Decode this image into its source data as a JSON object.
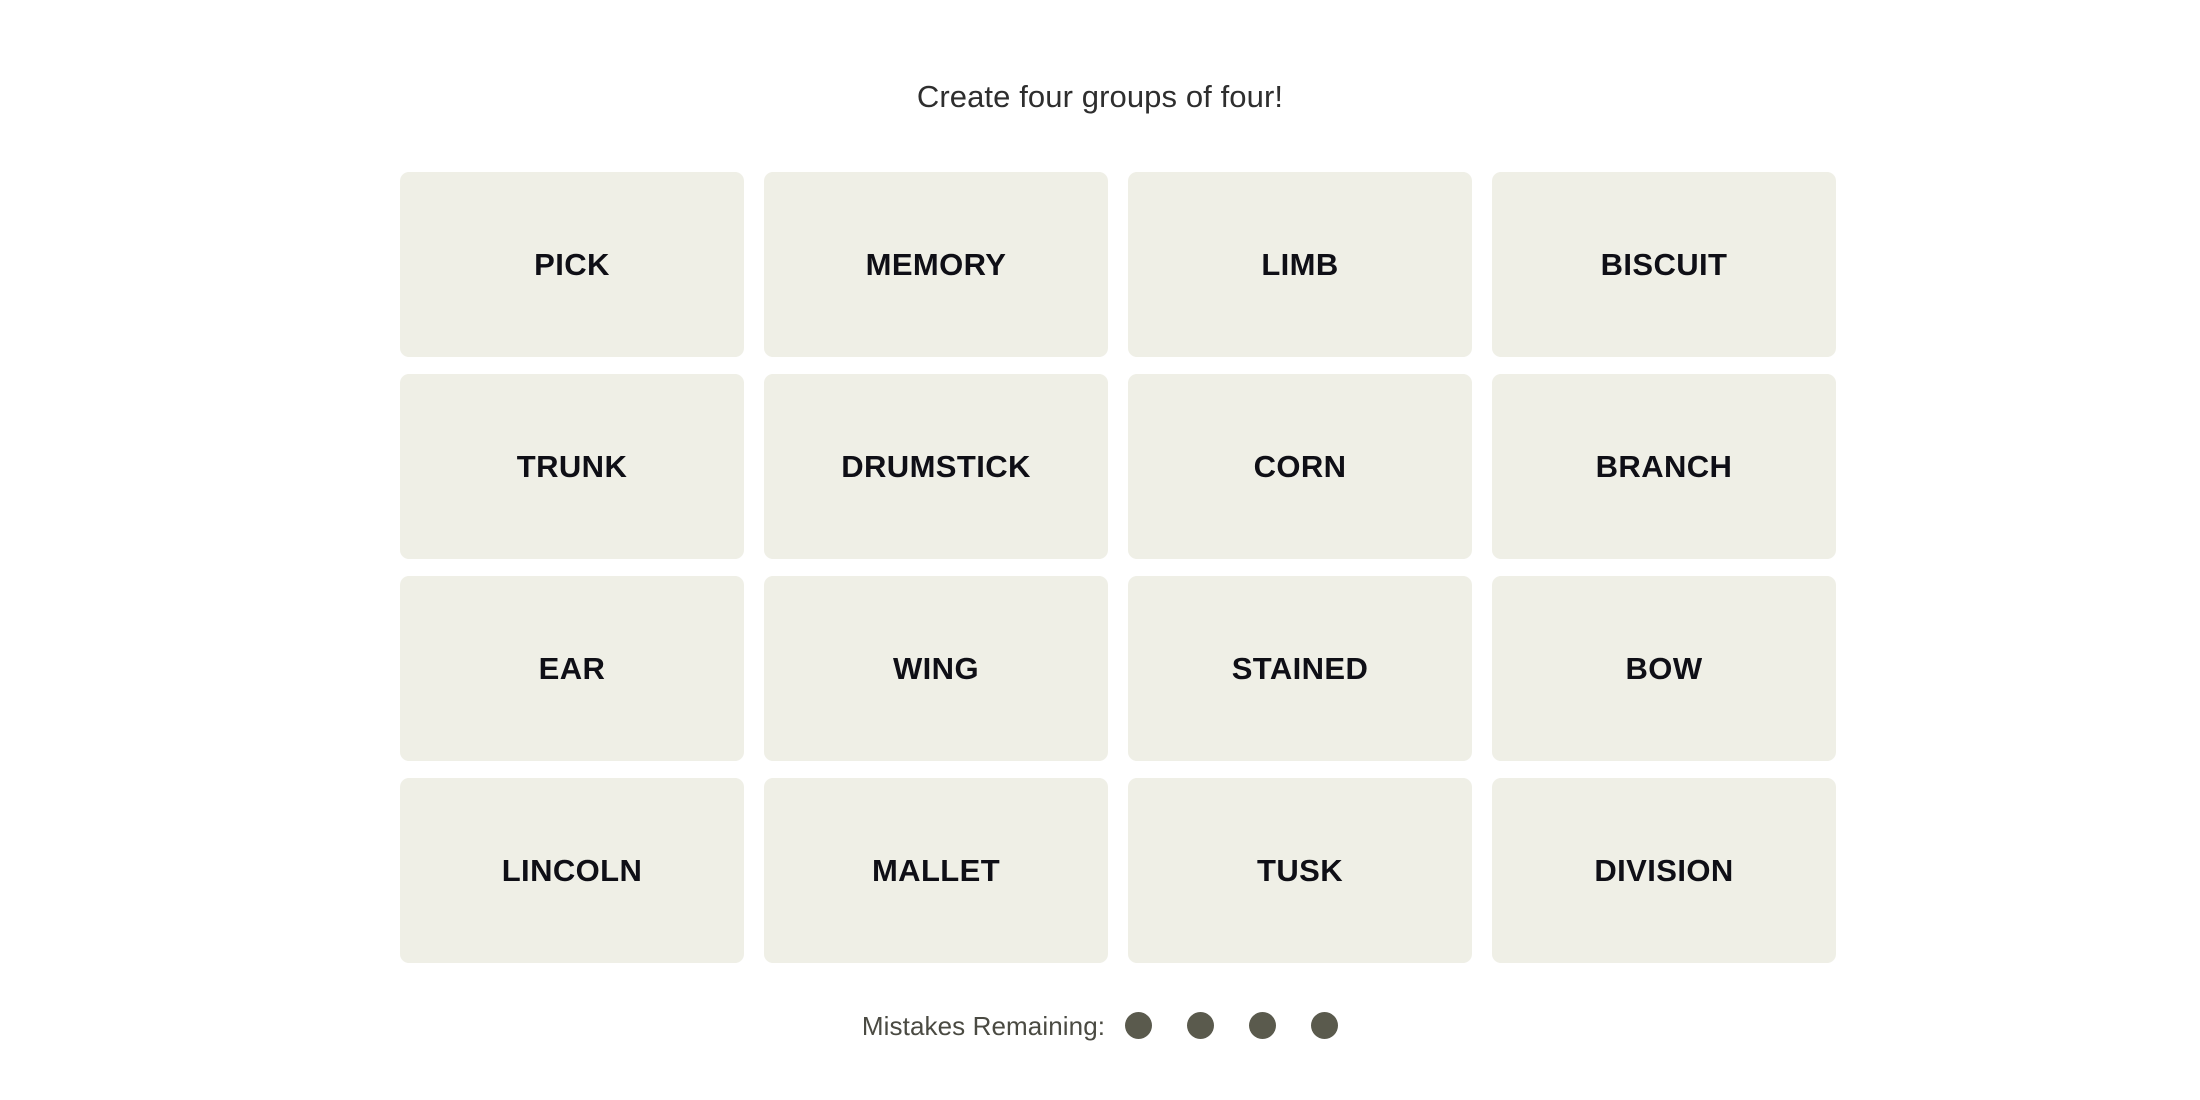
{
  "page": {
    "background_color": "#ffffff",
    "title": "Create four groups of four!"
  },
  "header": {
    "title": "Create four groups of four!"
  },
  "board": {
    "columns": 4,
    "rows": 4,
    "tile_color": "#efefe6",
    "tile_text_color": "#0f0f16",
    "tiles": [
      {
        "label": "PICK"
      },
      {
        "label": "MEMORY"
      },
      {
        "label": "LIMB"
      },
      {
        "label": "BISCUIT"
      },
      {
        "label": "TRUNK"
      },
      {
        "label": "DRUMSTICK"
      },
      {
        "label": "CORN"
      },
      {
        "label": "BRANCH"
      },
      {
        "label": "EAR"
      },
      {
        "label": "WING"
      },
      {
        "label": "STAINED"
      },
      {
        "label": "BOW"
      },
      {
        "label": "LINCOLN"
      },
      {
        "label": "MALLET"
      },
      {
        "label": "TUSK"
      },
      {
        "label": "DIVISION"
      }
    ]
  },
  "footer": {
    "mistakes_label": "Mistakes Remaining:",
    "mistakes_remaining": 4,
    "dot_color": "#5a5a4d",
    "dots": [
      {
        "name": "mistake-dot-1"
      },
      {
        "name": "mistake-dot-2"
      },
      {
        "name": "mistake-dot-3"
      },
      {
        "name": "mistake-dot-4"
      }
    ]
  }
}
